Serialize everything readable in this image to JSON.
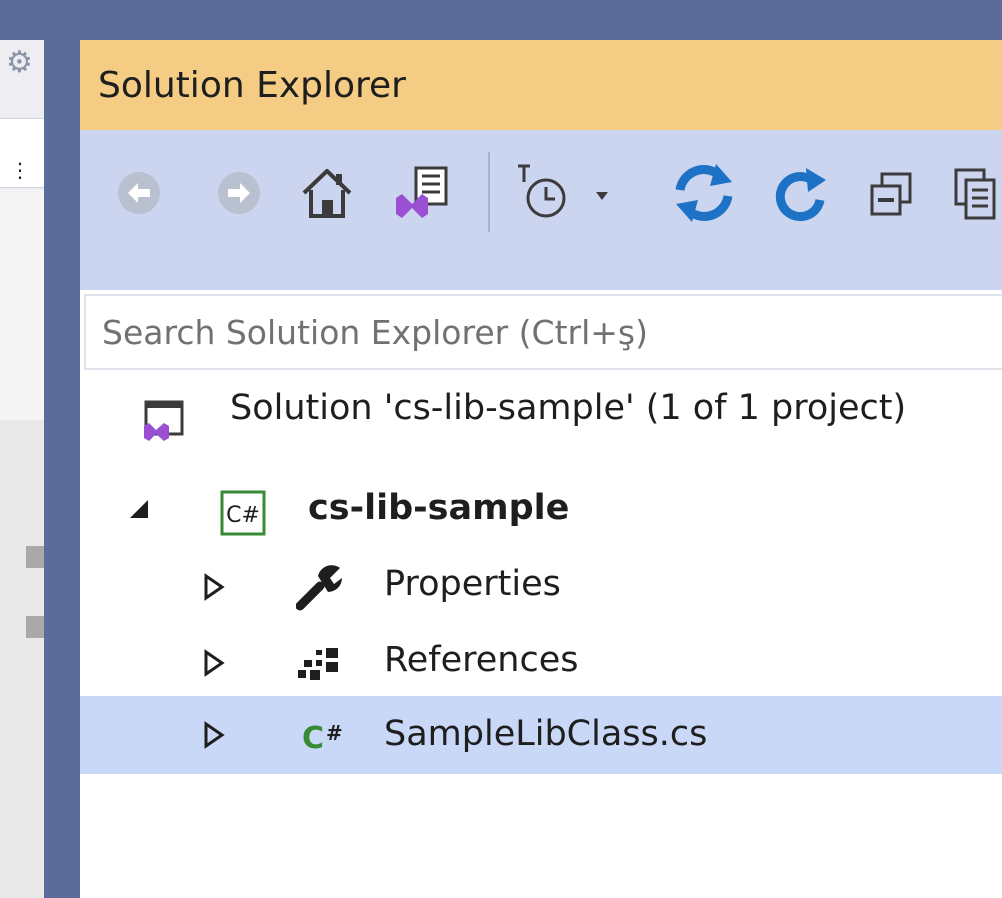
{
  "panel": {
    "title": "Solution Explorer"
  },
  "toolbar": {
    "buttons": [
      {
        "name": "back",
        "icon": "back-arrow-icon"
      },
      {
        "name": "forward",
        "icon": "forward-arrow-icon"
      },
      {
        "name": "home",
        "icon": "home-icon"
      },
      {
        "name": "switch-views",
        "icon": "switch-views-icon"
      },
      {
        "name": "pending-changes-filter",
        "icon": "history-clock-icon",
        "dropdown_glyph": "▾"
      },
      {
        "name": "sync-with-active-document",
        "icon": "sync-icon"
      },
      {
        "name": "refresh",
        "icon": "refresh-icon"
      },
      {
        "name": "collapse-all",
        "icon": "collapse-all-icon"
      },
      {
        "name": "show-all-files",
        "icon": "show-all-files-icon"
      }
    ]
  },
  "search": {
    "placeholder": "Search Solution Explorer (Ctrl+ş)",
    "value": ""
  },
  "tree": {
    "solution": {
      "label": "Solution 'cs-lib-sample' (1 of 1 project)",
      "icon": "solution-icon"
    },
    "project": {
      "label": "cs-lib-sample",
      "icon": "csharp-project-icon",
      "expander_glyph": "◢"
    },
    "items": [
      {
        "label": "Properties",
        "icon": "wrench-icon",
        "expander_glyph": "▷",
        "selected": false
      },
      {
        "label": "References",
        "icon": "references-icon",
        "expander_glyph": "▷",
        "selected": false
      },
      {
        "label": "SampleLibClass.cs",
        "icon": "csharp-file-icon",
        "expander_glyph": "▷",
        "selected": true
      }
    ]
  },
  "colors": {
    "frame": "#5d6b99",
    "title_bar": "#f5cc84",
    "toolbar": "#ccd5f0",
    "selection": "#c9d8f7",
    "accent_blue": "#1e72c5",
    "vs_purple": "#9b4fd3",
    "csharp_green": "#388a34"
  }
}
